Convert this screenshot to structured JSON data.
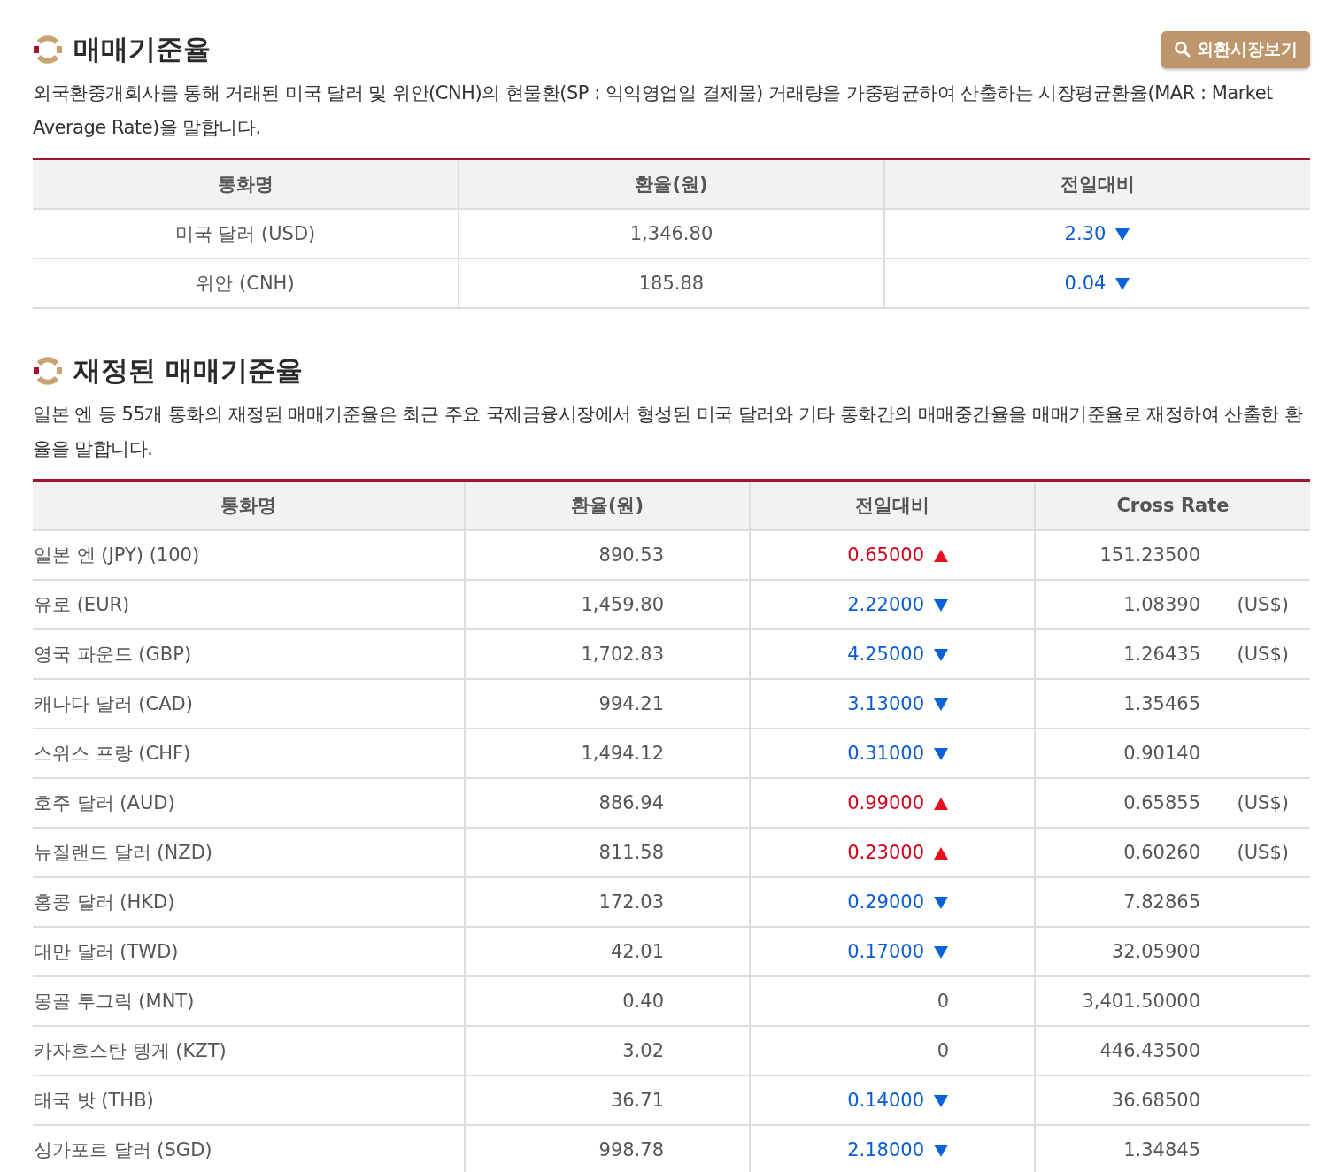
{
  "sections": [
    {
      "title": "매매기준율",
      "button": "외환시장보기",
      "description": "외국환중개회사를 통해 거래된 미국 달러 및 위안(CNH)의 현물환(SP : 익익영업일 결제물) 거래량을 가중평균하여 산출하는 시장평균환율(MAR : Market Average Rate)을 말합니다.",
      "table": {
        "columns": [
          "통화명",
          "환율(원)",
          "전일대비"
        ],
        "rows": [
          {
            "name": "미국 달러 (USD)",
            "rate": "1,346.80",
            "change": "2.30",
            "kind": "down"
          },
          {
            "name": "위안 (CNH)",
            "rate": "185.88",
            "change": "0.04",
            "kind": "down"
          }
        ]
      }
    },
    {
      "title": "재정된 매매기준율",
      "description": "일본 엔 등 55개 통화의 재정된 매매기준율은 최근 주요 국제금융시장에서 형성된 미국 달러와 기타 통화간의 매매중간율을 매매기준율로 재정하여 산출한 환율을 말합니다.",
      "table": {
        "columns": [
          "통화명",
          "환율(원)",
          "전일대비",
          "Cross Rate"
        ],
        "rows": [
          {
            "name": "일본 엔 (JPY) (100)",
            "rate": "890.53",
            "change": "0.65000",
            "kind": "up",
            "cross": "151.23500"
          },
          {
            "name": "유로 (EUR)",
            "rate": "1,459.80",
            "change": "2.22000",
            "kind": "down",
            "cross": "1.08390",
            "unit": "(US$)"
          },
          {
            "name": "영국 파운드 (GBP)",
            "rate": "1,702.83",
            "change": "4.25000",
            "kind": "down",
            "cross": "1.26435",
            "unit": "(US$)"
          },
          {
            "name": "캐나다 달러 (CAD)",
            "rate": "994.21",
            "change": "3.13000",
            "kind": "down",
            "cross": "1.35465"
          },
          {
            "name": "스위스 프랑 (CHF)",
            "rate": "1,494.12",
            "change": "0.31000",
            "kind": "down",
            "cross": "0.90140"
          },
          {
            "name": "호주 달러 (AUD)",
            "rate": "886.94",
            "change": "0.99000",
            "kind": "up",
            "cross": "0.65855",
            "unit": "(US$)"
          },
          {
            "name": "뉴질랜드 달러 (NZD)",
            "rate": "811.58",
            "change": "0.23000",
            "kind": "up",
            "cross": "0.60260",
            "unit": "(US$)"
          },
          {
            "name": "홍콩 달러 (HKD)",
            "rate": "172.03",
            "change": "0.29000",
            "kind": "down",
            "cross": "7.82865"
          },
          {
            "name": "대만 달러 (TWD)",
            "rate": "42.01",
            "change": "0.17000",
            "kind": "down",
            "cross": "32.05900"
          },
          {
            "name": "몽골 투그릭 (MNT)",
            "rate": "0.40",
            "change": "0",
            "kind": "none",
            "cross": "3,401.50000"
          },
          {
            "name": "카자흐스탄 텡게 (KZT)",
            "rate": "3.02",
            "change": "0",
            "kind": "none",
            "cross": "446.43500"
          },
          {
            "name": "태국 밧 (THB)",
            "rate": "36.71",
            "change": "0.14000",
            "kind": "down",
            "cross": "36.68500"
          },
          {
            "name": "싱가포르 달러 (SGD)",
            "rate": "998.78",
            "change": "2.18000",
            "kind": "down",
            "cross": "1.34845"
          }
        ]
      }
    }
  ]
}
